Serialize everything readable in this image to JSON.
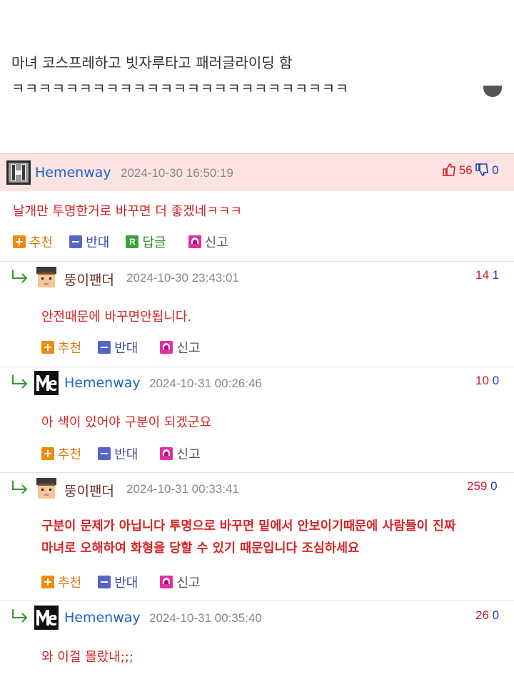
{
  "post": {
    "line1": "마녀 코스프레하고 빗자루타고 패러글라이딩 함",
    "line2": "ㅋㅋㅋㅋㅋㅋㅋㅋㅋㅋㅋㅋㅋㅋㅋㅋㅋㅋㅋㅋㅋㅋㅋㅋㅋ"
  },
  "actions": {
    "recommend": "추천",
    "oppose": "반대",
    "reply": "답글",
    "report": "신고"
  },
  "colors": {
    "highlight_bg": "#fde2e2",
    "comment_text": "#d52525",
    "author_blue": "#1a66c2",
    "up_red": "#d0192b",
    "down_blue": "#1a3fb5"
  },
  "comments": [
    {
      "author": "Hemenway",
      "date": "2024-10-30 16:50:19",
      "up": "56",
      "down": "0",
      "text": "날개만 투명한거로 바꾸면 더 좋겠네ㅋㅋㅋ",
      "avatar_icon": "block-h-avatar-icon"
    },
    {
      "author": "뚱이팬더",
      "date": "2024-10-30 23:43:01",
      "up": "14",
      "down": "1",
      "text": "안전때문에 바꾸면안됩니다.",
      "avatar_icon": "pixel-face-avatar-icon"
    },
    {
      "author": "Hemenway",
      "date": "2024-10-31 00:26:46",
      "up": "10",
      "down": "0",
      "text": "아 색이 있어야 구분이 되겠군요",
      "avatar_icon": "me-logo-avatar-icon"
    },
    {
      "author": "뚱이팬더",
      "date": "2024-10-31 00:33:41",
      "up": "259",
      "down": "0",
      "text_line1": "구분이 문제가 아닙니다 투명으로 바꾸면 밑에서 안보이기때문에 사람들이 진짜",
      "text_line2": "마녀로 오해하여 화형을 당할 수 있기 때문입니다 조심하세요",
      "avatar_icon": "pixel-face-avatar-icon"
    },
    {
      "author": "Hemenway",
      "date": "2024-10-31 00:35:40",
      "up": "26",
      "down": "0",
      "text": "와 이걸 몰랐내;;;",
      "avatar_icon": "me-logo-avatar-icon"
    }
  ]
}
